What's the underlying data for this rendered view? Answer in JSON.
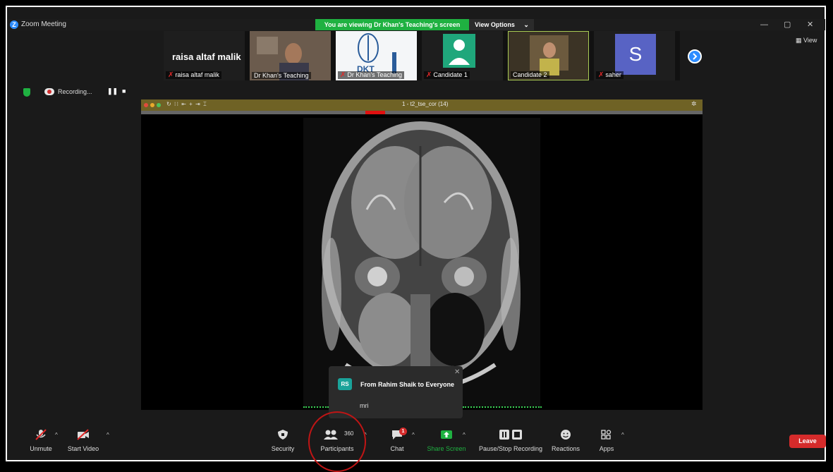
{
  "window": {
    "app_title": "Zoom Meeting",
    "viewing_banner": "You are viewing Dr Khan's Teaching's screen",
    "view_options": "View Options",
    "view_button": "View"
  },
  "thumbnails": {
    "name_tile": "raisa altaf malik",
    "tiles": [
      {
        "label": "raisa altaf malik",
        "muted": true
      },
      {
        "label": "Dr Khan's Teaching",
        "muted": false
      },
      {
        "label": "Dr Khan's Teaching",
        "muted": true
      },
      {
        "label": "Candidate 1",
        "muted": true
      },
      {
        "label": "Candidate 2",
        "muted": false
      },
      {
        "label": "saher",
        "muted": true
      }
    ],
    "avatar_letter": "S",
    "logo_text": "DKT"
  },
  "recording": {
    "label": "Recording..."
  },
  "viewer": {
    "title": "1 - t2_tse_cor (14)"
  },
  "chat_popup": {
    "avatar": "RS",
    "from": "From Rahim Shaik to Everyone",
    "message": "mri"
  },
  "toolbar": {
    "unmute": "Unmute",
    "start_video": "Start Video",
    "security": "Security",
    "participants": "Participants",
    "participants_count": "360",
    "chat": "Chat",
    "chat_badge": "1",
    "share_screen": "Share Screen",
    "pause_stop_recording": "Pause/Stop Recording",
    "reactions": "Reactions",
    "apps": "Apps",
    "leave": "Leave"
  },
  "colors": {
    "banner_green": "#1fb141",
    "leave_red": "#d52b2b",
    "share_green": "#1fb141",
    "accent_blue": "#2d8cff"
  }
}
